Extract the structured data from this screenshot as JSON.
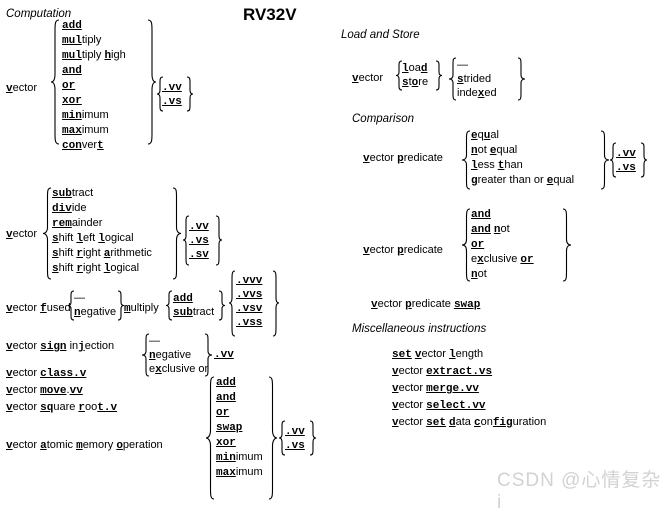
{
  "title": "RV32V",
  "watermark": "CSDN @心情复杂i",
  "sections": {
    "computation": "Computation",
    "load_store": "Load and Store",
    "comparison": "Comparison",
    "misc": "Miscellaneous instructions"
  },
  "labels": {
    "vector": "vector",
    "vector_fused": "vector fused",
    "multiply": "multiply",
    "vector_sign_injection": "vector sign injection",
    "vector_class": "vector class.v",
    "vector_move": "vector move.vv",
    "vector_square_root": "vector square root.v",
    "vector_atomic": "vector atomic memory operation",
    "vector_predicate": "vector predicate",
    "vector_predicate_swap": "vector predicate swap"
  },
  "groups": {
    "arith_vv_vs": [
      "add",
      "multiply",
      "multiply high",
      "and",
      "or",
      "xor",
      "minimum",
      "maximum",
      "convert"
    ],
    "arith_vv_vs_sv": [
      "subtract",
      "divide",
      "remainder",
      "shift left logical",
      "shift right arithmetic",
      "shift right logical"
    ],
    "fused_sign": [
      "—",
      "negative"
    ],
    "fused_op": [
      "add",
      "subtract"
    ],
    "sign_injection": [
      "—",
      "negative",
      "exclusive or"
    ],
    "amo_ops": [
      "add",
      "and",
      "or",
      "swap",
      "xor",
      "minimum",
      "maximum"
    ],
    "ls_dir": [
      "load",
      "store"
    ],
    "ls_mode": [
      "—",
      "strided",
      "indexed"
    ],
    "compare": [
      "equal",
      "not equal",
      "less than",
      "greater than or equal"
    ],
    "predicate": [
      "and",
      "and not",
      "or",
      "exclusive or",
      "not"
    ]
  },
  "suffixes": {
    "vv_vs": [
      ".vv",
      ".vs"
    ],
    "vv_vs_sv": [
      ".vv",
      ".vs",
      ".sv"
    ],
    "vvv_vvs_vsv_vss": [
      ".vvv",
      ".vvs",
      ".vsv",
      ".vss"
    ],
    "vv": [
      ".vv"
    ]
  },
  "misc_instructions": [
    "set vector length",
    "vector extract.vs",
    "vector merge.vv",
    "vector select.vv",
    "vector set data configuration"
  ]
}
